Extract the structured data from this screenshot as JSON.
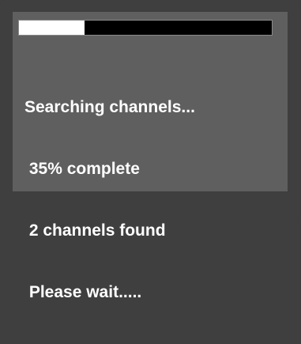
{
  "progress": {
    "fraction": 0.26,
    "track_color": "#000000",
    "fill_color": "#ffffff"
  },
  "status": {
    "line1": "Searching channels...",
    "line2": " 35% complete",
    "line3": " 2 channels found",
    "line4": " Please wait....."
  },
  "colors": {
    "background": "#3f3f3f",
    "panel": "#5f5f5f",
    "text": "#ffffff"
  }
}
